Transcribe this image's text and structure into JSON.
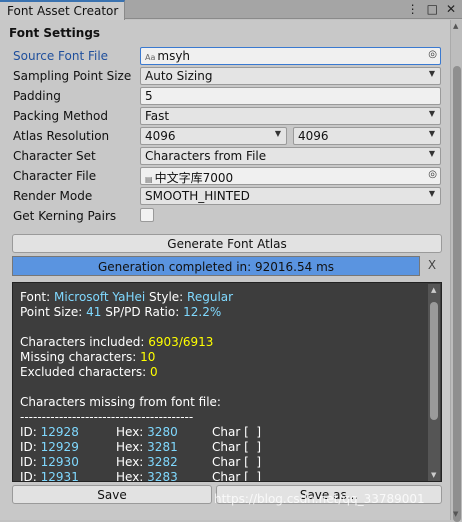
{
  "window": {
    "tab_title": "Font Asset Creator",
    "menu_icon": "⋮",
    "maximize_icon": "□",
    "close_icon": "✕"
  },
  "section": {
    "title": "Font Settings"
  },
  "fields": {
    "source_font_file": {
      "label": "Source Font File",
      "value": "msyh",
      "icon": "Aa"
    },
    "sampling_point_size": {
      "label": "Sampling Point Size",
      "value": "Auto Sizing"
    },
    "padding": {
      "label": "Padding",
      "value": "5"
    },
    "packing_method": {
      "label": "Packing Method",
      "value": "Fast"
    },
    "atlas_resolution": {
      "label": "Atlas Resolution",
      "width": "4096",
      "height": "4096"
    },
    "character_set": {
      "label": "Character Set",
      "value": "Characters from File"
    },
    "character_file": {
      "label": "Character File",
      "value": "中文字库7000"
    },
    "render_mode": {
      "label": "Render Mode",
      "value": "SMOOTH_HINTED"
    },
    "get_kerning_pairs": {
      "label": "Get Kerning Pairs",
      "checked": false
    }
  },
  "buttons": {
    "generate": "Generate Font Atlas",
    "save": "Save",
    "save_as": "Save as...",
    "close_progress": "X"
  },
  "progress": {
    "text": "Generation completed in: 92016.54 ms",
    "fraction": 1.0
  },
  "output": {
    "font_label": "Font:",
    "font_value": "Microsoft YaHei",
    "style_label": "Style:",
    "style_value": "Regular",
    "point_size_label": "Point Size:",
    "point_size_value": "41",
    "ratio_label": "SP/PD Ratio:",
    "ratio_value": "12.2%",
    "included_label": "Characters included:",
    "included_value": "6903/6913",
    "missing_label": "Missing characters:",
    "missing_value": "10",
    "excluded_label": "Excluded characters:",
    "excluded_value": "0",
    "missing_header": "Characters missing from font file:",
    "divider": "----------------------------------------",
    "missing_rows": [
      {
        "id_label": "ID:",
        "id": "12928",
        "hex_label": "Hex:",
        "hex": "3280",
        "char_label": "Char [",
        "char_end": "]"
      },
      {
        "id_label": "ID:",
        "id": "12929",
        "hex_label": "Hex:",
        "hex": "3281",
        "char_label": "Char [",
        "char_end": "]"
      },
      {
        "id_label": "ID:",
        "id": "12930",
        "hex_label": "Hex:",
        "hex": "3282",
        "char_label": "Char [",
        "char_end": "]"
      },
      {
        "id_label": "ID:",
        "id": "12931",
        "hex_label": "Hex:",
        "hex": "3283",
        "char_label": "Char [",
        "char_end": "]"
      }
    ]
  },
  "watermark": "https://blog.csdn.net/qq_33789001",
  "colors": {
    "accent": "#3a72b0",
    "progress": "#5a94e0",
    "cyan": "#80d9ff",
    "yellow": "#ffff00",
    "console_bg": "#3d3d3d"
  }
}
